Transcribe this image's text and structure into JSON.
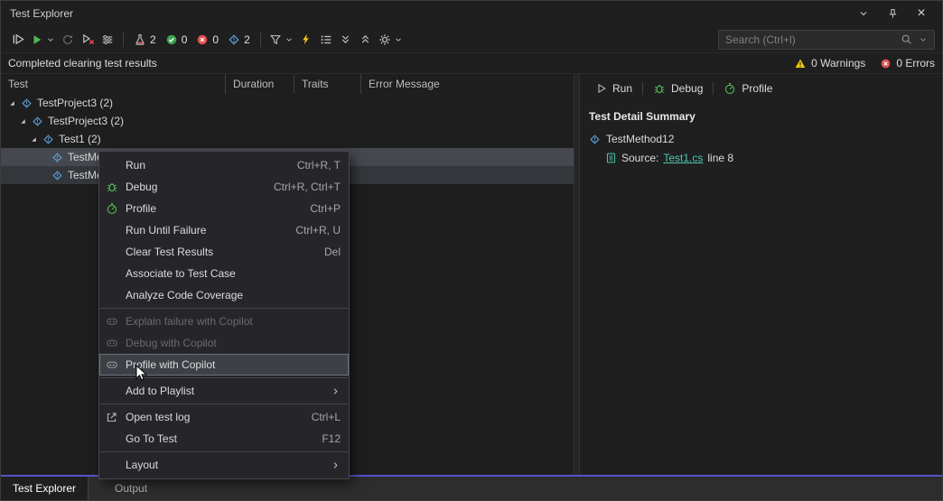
{
  "colors": {
    "accent_line": "#5254cc",
    "green": "#53b854",
    "red": "#f14c4c",
    "blue_diamond": "#5c9fd8",
    "teal_link": "#4ec9b0",
    "warning_yellow": "#f2cc0c"
  },
  "titlebar": {
    "title": "Test Explorer"
  },
  "toolbar": {
    "badges": [
      {
        "name": "total-tests",
        "icon": "flask-icon",
        "count": "2"
      },
      {
        "name": "passed-tests",
        "icon": "passed-circle-check-icon",
        "count": "0"
      },
      {
        "name": "failed-tests",
        "icon": "failed-circle-x-icon",
        "count": "0"
      },
      {
        "name": "not-run-tests",
        "icon": "not-run-diamond-icon",
        "count": "2"
      }
    ],
    "search_placeholder": "Search (Ctrl+l)"
  },
  "status": {
    "message": "Completed clearing test results",
    "warnings": "0 Warnings",
    "errors": "0 Errors"
  },
  "table": {
    "columns": [
      "Test",
      "Duration",
      "Traits",
      "Error Message"
    ]
  },
  "tree": {
    "rows": [
      {
        "label": "TestProject3 (2)"
      },
      {
        "label": "TestProject3 (2)"
      },
      {
        "label": "Test1 (2)"
      },
      {
        "label": "TestMethod12"
      },
      {
        "label": "TestMe"
      }
    ]
  },
  "context_menu": {
    "items": [
      {
        "label": "Run",
        "shortcut": "Ctrl+R, T"
      },
      {
        "label": "Debug",
        "shortcut": "Ctrl+R, Ctrl+T"
      },
      {
        "label": "Profile",
        "shortcut": "Ctrl+P"
      },
      {
        "label": "Run Until Failure",
        "shortcut": "Ctrl+R, U"
      },
      {
        "label": "Clear Test Results",
        "shortcut": "Del"
      },
      {
        "label": "Associate to Test Case",
        "shortcut": ""
      },
      {
        "label": "Analyze Code Coverage",
        "shortcut": ""
      },
      {
        "label": "Explain failure with Copilot",
        "shortcut": ""
      },
      {
        "label": "Debug with Copilot",
        "shortcut": ""
      },
      {
        "label": "Profile with Copilot",
        "shortcut": ""
      },
      {
        "label": "Add to Playlist",
        "shortcut": ""
      },
      {
        "label": "Open test log",
        "shortcut": "Ctrl+L"
      },
      {
        "label": "Go To Test",
        "shortcut": "F12"
      },
      {
        "label": "Layout",
        "shortcut": ""
      }
    ]
  },
  "detail": {
    "run_label": "Run",
    "debug_label": "Debug",
    "profile_label": "Profile",
    "heading": "Test Detail Summary",
    "test_name": "TestMethod12",
    "source_label": "Source:",
    "source_file": "Test1.cs",
    "source_line": "line 8"
  },
  "tabs": [
    {
      "label": "Test Explorer"
    },
    {
      "label": "Output"
    }
  ]
}
